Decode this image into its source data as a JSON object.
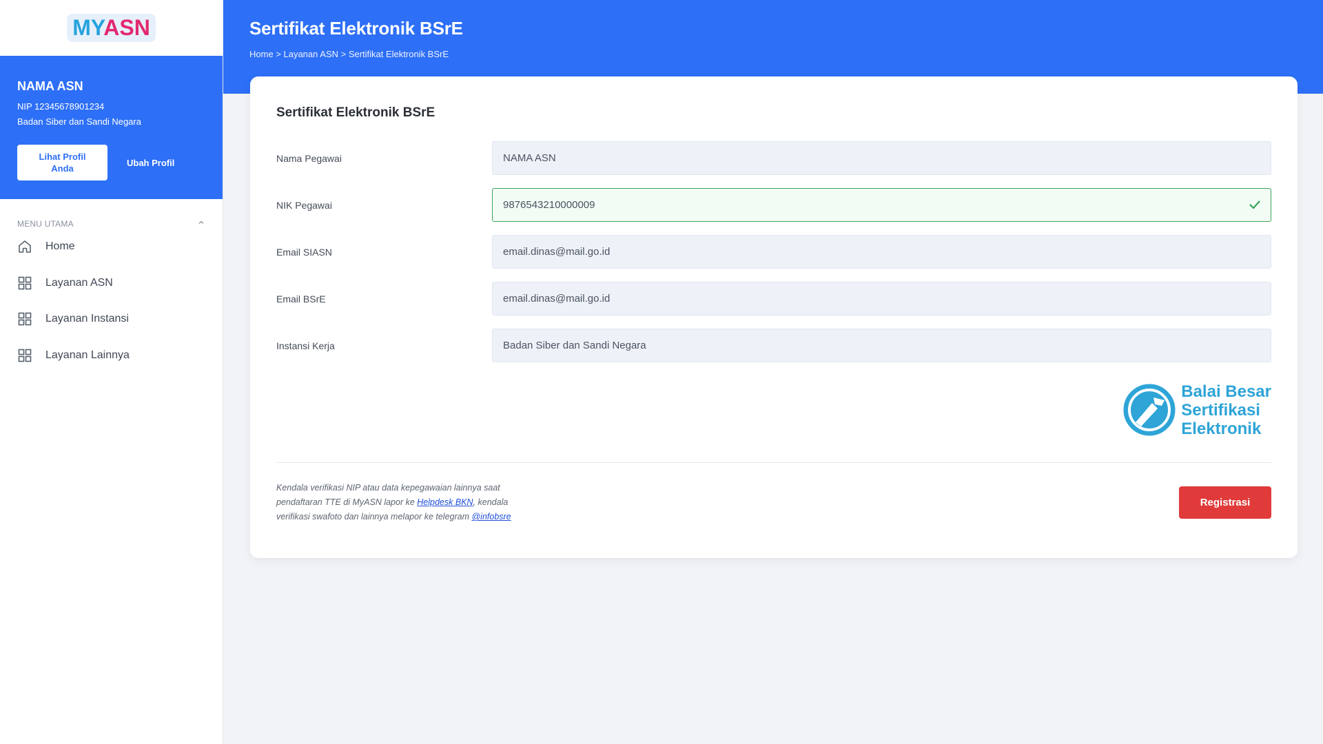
{
  "logo": {
    "part1": "MY",
    "part2": "ASN"
  },
  "profile": {
    "name": "NAMA ASN",
    "nip": "NIP 12345678901234",
    "agency": "Badan Siber dan Sandi Negara",
    "view_profile_label": "Lihat Profil Anda",
    "edit_profile_label": "Ubah Profil"
  },
  "menu": {
    "header": "MENU UTAMA",
    "items": [
      {
        "label": "Home",
        "icon": "home-icon"
      },
      {
        "label": "Layanan ASN",
        "icon": "grid-icon"
      },
      {
        "label": "Layanan Instansi",
        "icon": "grid-icon"
      },
      {
        "label": "Layanan Lainnya",
        "icon": "grid-icon"
      }
    ]
  },
  "header": {
    "title": "Sertifikat Elektronik BSrE",
    "breadcrumb": "Home > Layanan ASN > Sertifikat Elektronik BSrE"
  },
  "card": {
    "title": "Sertifikat Elektronik BSrE",
    "fields": [
      {
        "label": "Nama Pegawai",
        "value": "NAMA ASN"
      },
      {
        "label": "NIK Pegawai",
        "value": "9876543210000009",
        "valid": true
      },
      {
        "label": "Email SIASN",
        "value": "email.dinas@mail.go.id"
      },
      {
        "label": "Email BSrE",
        "value": "email.dinas@mail.go.id"
      },
      {
        "label": "Instansi Kerja",
        "value": "Badan Siber dan Sandi Negara"
      }
    ],
    "bsre_logo": {
      "line1": "Balai Besar",
      "line2": "Sertifikasi",
      "line3": "Elektronik"
    },
    "note": {
      "part1": "Kendala verifikasi NIP atau data kepegawaian lainnya saat pendaftaran TTE di MyASN lapor ke ",
      "link1": "Helpdesk BKN",
      "part2": ", kendala verifikasi swafoto dan lainnya melapor ke telegram ",
      "link2": "@infobsre"
    },
    "register_label": "Registrasi"
  },
  "colors": {
    "primary": "#2d6ff6",
    "danger": "#e03a3a",
    "success": "#3aa35a",
    "bsre_blue": "#2ea4d7"
  }
}
